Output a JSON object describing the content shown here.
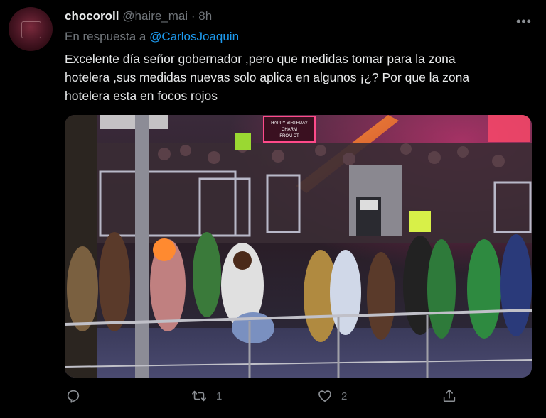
{
  "tweet": {
    "display_name": "chocoroll",
    "handle": "@haire_mai",
    "separator": "·",
    "time": "8h",
    "more_label": "•••",
    "reply_prefix": "En respuesta a",
    "reply_to": "@CarlosJoaquin",
    "text_lines": [
      "Excelente día señor gobernador ,pero que medidas tomar para la zona",
      "hotelera ,sus medidas nuevas  solo aplica en algunos ¡¿?  Por que la zona",
      "hotelera esta en focos rojos"
    ],
    "media": {
      "description_icon": "nightclub-crowd-photo",
      "sign_text": [
        "HAPPY BIRTHDAY",
        "CHARM",
        "FROM CT"
      ]
    }
  },
  "actions": {
    "reply": {
      "icon": "reply-icon",
      "count": ""
    },
    "retweet": {
      "icon": "retweet-icon",
      "count": "1"
    },
    "like": {
      "icon": "heart-icon",
      "count": "2"
    },
    "share": {
      "icon": "share-icon",
      "count": ""
    }
  },
  "colors": {
    "background": "#000000",
    "text": "#e7e9ea",
    "muted": "#71767b",
    "link": "#1d9bf0"
  }
}
